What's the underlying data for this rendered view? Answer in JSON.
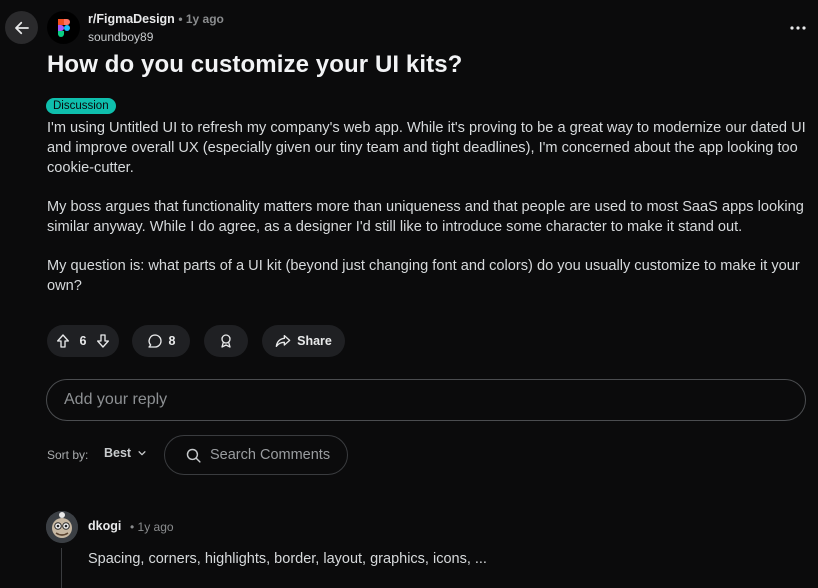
{
  "post": {
    "subreddit": "r/FigmaDesign",
    "time": "1y ago",
    "author": "soundboy89",
    "title": "How do you customize your UI kits?",
    "flair": "Discussion",
    "paragraphs": [
      "I'm using Untitled UI to refresh my company's web app. While it's proving to be a great way to modernize our dated UI and improve overall UX (especially given our tiny team and tight deadlines), I'm concerned about the app looking too cookie-cutter.",
      "My boss argues that functionality matters more than uniqueness and that people are used to most SaaS apps looking similar anyway. While I do agree, as a designer I'd still like to introduce some character to make it stand out.",
      "My question is: what parts of a UI kit (beyond just changing font and colors) do you usually customize to make it your own?"
    ],
    "votes": "6",
    "comments": "8",
    "share_label": "Share"
  },
  "reply": {
    "placeholder": "Add your reply"
  },
  "sort": {
    "label": "Sort by:",
    "value": "Best"
  },
  "search": {
    "placeholder": "Search Comments"
  },
  "comment": {
    "author": "dkogi",
    "time": "1y ago",
    "text": "Spacing, corners, highlights, border, layout, graphics, icons, ..."
  },
  "icons": {
    "back": "arrow-left-icon",
    "subreddit": "figma-logo-icon",
    "overflow": "more-horizontal-icon",
    "upvote": "upvote-icon",
    "downvote": "downvote-icon",
    "comment": "comment-icon",
    "award": "award-icon",
    "share": "share-icon",
    "chevron": "chevron-down-icon",
    "search": "search-icon"
  },
  "colors": {
    "background": "#0b0b0c",
    "flair": "#0fbfad",
    "pill": "#1f2023",
    "text": "#d7dadc"
  }
}
